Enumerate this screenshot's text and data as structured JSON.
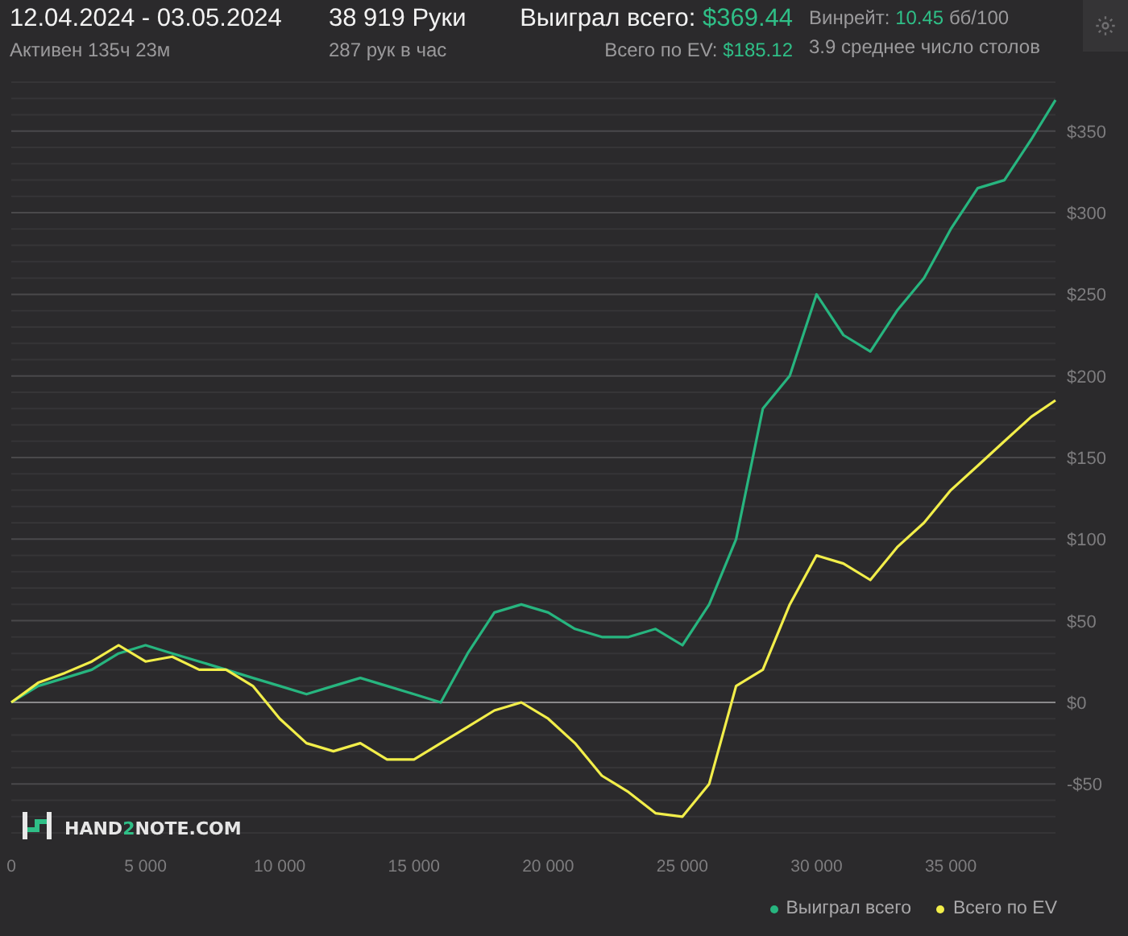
{
  "header": {
    "period": "12.04.2024 - 03.05.2024",
    "active": "Активен 135ч 23м",
    "hands": "38 919 Руки",
    "hands_per_hour": "287 рук в час",
    "won": {
      "label": "Выиграл всего:",
      "value": "$369.44"
    },
    "ev": {
      "label": "Всего по EV:",
      "value": "$185.12"
    },
    "winrate": {
      "label": "Винрейт:",
      "value": "10.45",
      "unit": "бб/100"
    },
    "tables": "3.9 среднее число столов"
  },
  "logo": {
    "before": "HAND",
    "mark": "2",
    "after": "NOTE.COM"
  },
  "chart": {
    "chart_data": {
      "type": "line",
      "x": [
        0,
        1000,
        2000,
        3000,
        4000,
        5000,
        6000,
        7000,
        8000,
        9000,
        10000,
        11000,
        12000,
        13000,
        14000,
        15000,
        16000,
        17000,
        18000,
        19000,
        20000,
        21000,
        22000,
        23000,
        24000,
        25000,
        26000,
        27000,
        28000,
        29000,
        30000,
        31000,
        32000,
        33000,
        34000,
        35000,
        36000,
        37000,
        38000,
        38900
      ],
      "series": [
        {
          "name": "Выиграл всего",
          "color": "#27b57f",
          "values": [
            0,
            10,
            15,
            20,
            30,
            35,
            30,
            25,
            20,
            15,
            10,
            5,
            10,
            15,
            10,
            5,
            0,
            30,
            55,
            60,
            55,
            45,
            40,
            40,
            45,
            35,
            60,
            100,
            180,
            200,
            250,
            225,
            215,
            240,
            260,
            290,
            315,
            320,
            345,
            369
          ]
        },
        {
          "name": "Всего по EV",
          "color": "#f2ee4a",
          "values": [
            0,
            12,
            18,
            25,
            35,
            25,
            28,
            20,
            20,
            10,
            -10,
            -25,
            -30,
            -25,
            -35,
            -35,
            -25,
            -15,
            -5,
            0,
            -10,
            -25,
            -45,
            -55,
            -68,
            -70,
            -50,
            10,
            20,
            60,
            90,
            85,
            75,
            95,
            110,
            130,
            145,
            160,
            175,
            185
          ]
        }
      ],
      "grid": true,
      "xlim": [
        0,
        38900
      ],
      "ylim": [
        -80,
        380
      ],
      "xticks": [
        {
          "value": 0,
          "label": "0"
        },
        {
          "value": 5000,
          "label": "5 000"
        },
        {
          "value": 10000,
          "label": "10 000"
        },
        {
          "value": 15000,
          "label": "15 000"
        },
        {
          "value": 20000,
          "label": "20 000"
        },
        {
          "value": 25000,
          "label": "25 000"
        },
        {
          "value": 30000,
          "label": "30 000"
        },
        {
          "value": 35000,
          "label": "35 000"
        }
      ],
      "yticks": [
        {
          "value": -50,
          "label": "-$50"
        },
        {
          "value": 0,
          "label": "$0"
        },
        {
          "value": 50,
          "label": "$50"
        },
        {
          "value": 100,
          "label": "$100"
        },
        {
          "value": 150,
          "label": "$150"
        },
        {
          "value": 200,
          "label": "$200"
        },
        {
          "value": 250,
          "label": "$250"
        },
        {
          "value": 300,
          "label": "$300"
        },
        {
          "value": 350,
          "label": "$350"
        }
      ]
    }
  }
}
